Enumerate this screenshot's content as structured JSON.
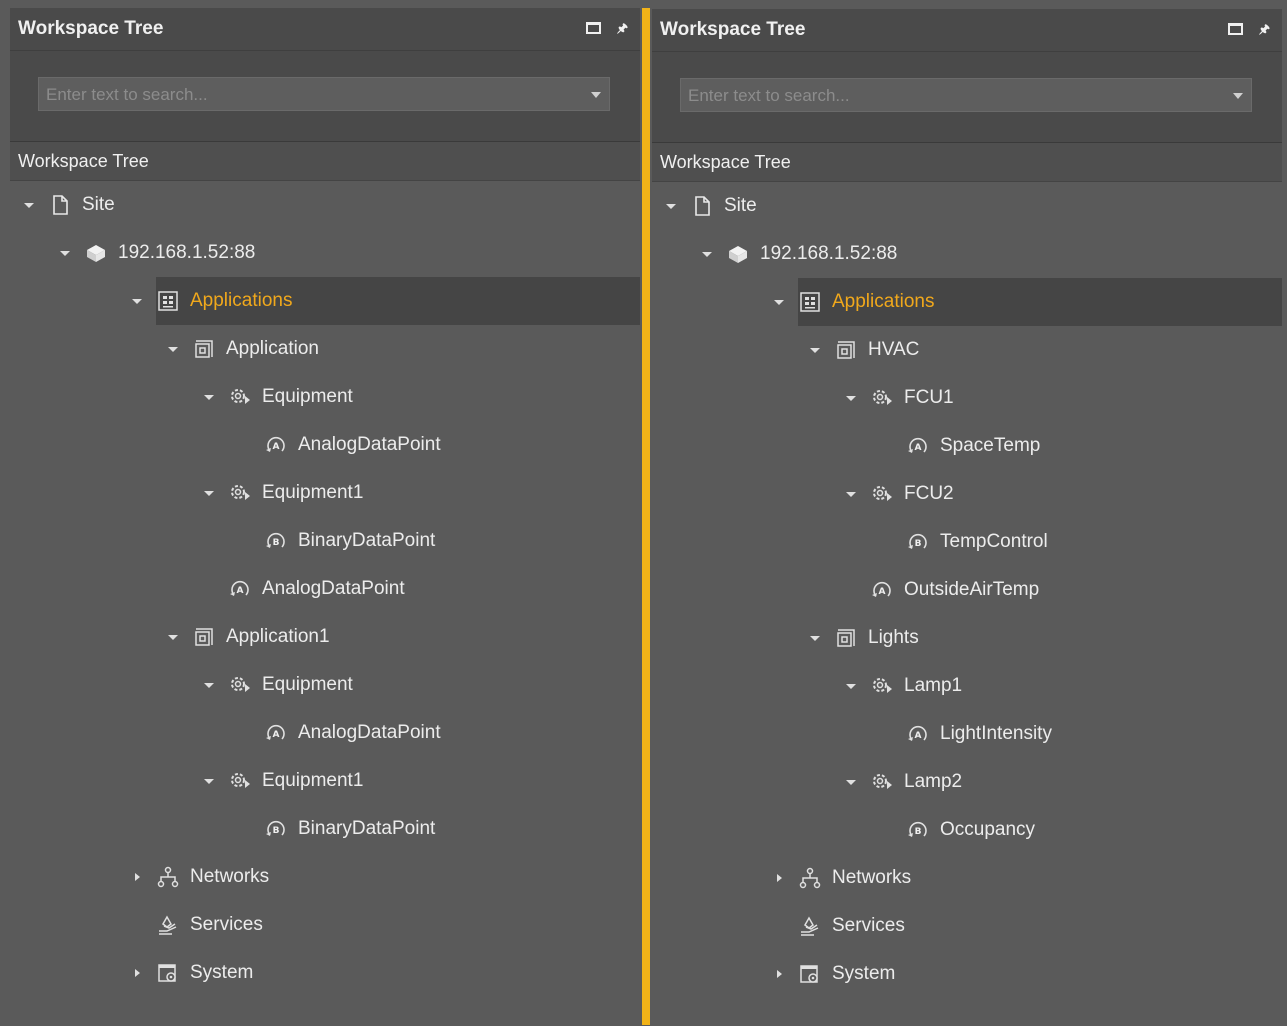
{
  "left": {
    "header": {
      "title": "Workspace Tree"
    },
    "search": {
      "placeholder": "Enter text to search..."
    },
    "section_title": "Workspace Tree",
    "tree": [
      {
        "label": "Site",
        "level": 0,
        "icon": "page-icon",
        "toggle": "down",
        "selected": false
      },
      {
        "label": "192.168.1.52:88",
        "level": 1,
        "icon": "server-icon",
        "toggle": "down",
        "selected": false
      },
      {
        "label": "Applications",
        "level": 3,
        "icon": "applications-icon",
        "toggle": "down",
        "selected": true
      },
      {
        "label": "Application",
        "level": 4,
        "icon": "application-icon",
        "toggle": "down",
        "selected": false
      },
      {
        "label": "Equipment",
        "level": 5,
        "icon": "equipment-icon",
        "toggle": "down",
        "selected": false
      },
      {
        "label": "AnalogDataPoint",
        "level": 6,
        "icon": "analog-datapoint-icon",
        "toggle": "none",
        "selected": false
      },
      {
        "label": "Equipment1",
        "level": 5,
        "icon": "equipment-icon",
        "toggle": "down",
        "selected": false
      },
      {
        "label": "BinaryDataPoint",
        "level": 6,
        "icon": "binary-datapoint-icon",
        "toggle": "none",
        "selected": false
      },
      {
        "label": "AnalogDataPoint",
        "level": 5,
        "icon": "analog-datapoint-icon",
        "toggle": "none",
        "selected": false
      },
      {
        "label": "Application1",
        "level": 4,
        "icon": "application-icon",
        "toggle": "down",
        "selected": false
      },
      {
        "label": "Equipment",
        "level": 5,
        "icon": "equipment-icon",
        "toggle": "down",
        "selected": false
      },
      {
        "label": "AnalogDataPoint",
        "level": 6,
        "icon": "analog-datapoint-icon",
        "toggle": "none",
        "selected": false
      },
      {
        "label": "Equipment1",
        "level": 5,
        "icon": "equipment-icon",
        "toggle": "down",
        "selected": false
      },
      {
        "label": "BinaryDataPoint",
        "level": 6,
        "icon": "binary-datapoint-icon",
        "toggle": "none",
        "selected": false
      },
      {
        "label": "Networks",
        "level": 3,
        "icon": "networks-icon",
        "toggle": "right",
        "selected": false
      },
      {
        "label": "Services",
        "level": 3,
        "icon": "services-icon",
        "toggle": "none",
        "selected": false
      },
      {
        "label": "System",
        "level": 3,
        "icon": "system-icon",
        "toggle": "right",
        "selected": false
      }
    ]
  },
  "right": {
    "header": {
      "title": "Workspace Tree"
    },
    "search": {
      "placeholder": "Enter text to search..."
    },
    "section_title": "Workspace Tree",
    "tree": [
      {
        "label": "Site",
        "level": 0,
        "icon": "page-icon",
        "toggle": "down",
        "selected": false
      },
      {
        "label": "192.168.1.52:88",
        "level": 1,
        "icon": "server-icon",
        "toggle": "down",
        "selected": false
      },
      {
        "label": "Applications",
        "level": 3,
        "icon": "applications-icon",
        "toggle": "down",
        "selected": true
      },
      {
        "label": "HVAC",
        "level": 4,
        "icon": "application-icon",
        "toggle": "down",
        "selected": false
      },
      {
        "label": "FCU1",
        "level": 5,
        "icon": "equipment-icon",
        "toggle": "down",
        "selected": false
      },
      {
        "label": "SpaceTemp",
        "level": 6,
        "icon": "analog-datapoint-icon",
        "toggle": "none",
        "selected": false
      },
      {
        "label": "FCU2",
        "level": 5,
        "icon": "equipment-icon",
        "toggle": "down",
        "selected": false
      },
      {
        "label": "TempControl",
        "level": 6,
        "icon": "binary-datapoint-icon",
        "toggle": "none",
        "selected": false
      },
      {
        "label": "OutsideAirTemp",
        "level": 5,
        "icon": "analog-datapoint-icon",
        "toggle": "none",
        "selected": false
      },
      {
        "label": "Lights",
        "level": 4,
        "icon": "application-icon",
        "toggle": "down",
        "selected": false
      },
      {
        "label": "Lamp1",
        "level": 5,
        "icon": "equipment-icon",
        "toggle": "down",
        "selected": false
      },
      {
        "label": "LightIntensity",
        "level": 6,
        "icon": "analog-datapoint-icon",
        "toggle": "none",
        "selected": false
      },
      {
        "label": "Lamp2",
        "level": 5,
        "icon": "equipment-icon",
        "toggle": "down",
        "selected": false
      },
      {
        "label": "Occupancy",
        "level": 6,
        "icon": "binary-datapoint-icon",
        "toggle": "none",
        "selected": false
      },
      {
        "label": "Networks",
        "level": 3,
        "icon": "networks-icon",
        "toggle": "right",
        "selected": false
      },
      {
        "label": "Services",
        "level": 3,
        "icon": "services-icon",
        "toggle": "none",
        "selected": false
      },
      {
        "label": "System",
        "level": 3,
        "icon": "system-icon",
        "toggle": "right",
        "selected": false
      }
    ]
  },
  "colors": {
    "accent": "#f2b318",
    "selected_text": "#f0a81c",
    "background": "#5a5a5a"
  }
}
